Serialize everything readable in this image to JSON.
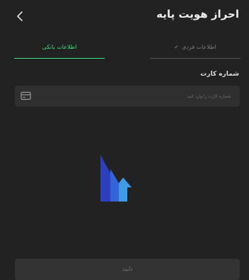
{
  "header": {
    "title": "احراز هویت پایه",
    "back_icon": "chevron-left-icon"
  },
  "tabs": [
    {
      "label": "اطلاعات بانکی",
      "active": true
    },
    {
      "label": "اطلاعات فردی",
      "active": false,
      "icon": "check-icon"
    }
  ],
  "card_field": {
    "label": "شماره کارت",
    "placeholder": "شماره کارت را وارد کنید",
    "value": "",
    "icon": "credit-card-icon"
  },
  "logo": {
    "icon": "app-logo-icon"
  },
  "confirm_button": {
    "label": "تایید"
  },
  "colors": {
    "background": "#222222",
    "accent": "#3ddc84",
    "input_background": "#2f2f2f",
    "logo_dark_blue": "#2b3fbf",
    "logo_blue": "#3564d8",
    "logo_light_blue": "#3d9be8"
  }
}
